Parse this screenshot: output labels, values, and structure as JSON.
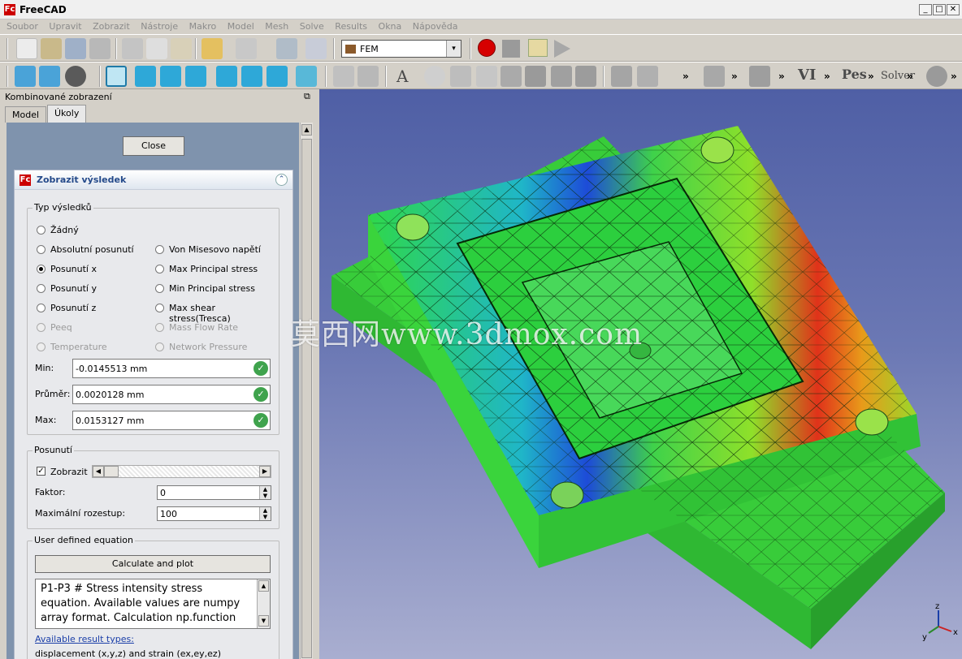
{
  "window": {
    "title": "FreeCAD",
    "logo": "Fc",
    "min": "_",
    "max": "□",
    "close": "✕"
  },
  "menu": [
    "Soubor",
    "Upravit",
    "Zobrazit",
    "Nástroje",
    "Makro",
    "Model",
    "Mesh",
    "Solve",
    "Results",
    "Okna",
    "Nápověda"
  ],
  "toolbar": {
    "workbench": "FEM",
    "workbench_arrow": "▾",
    "chevron": "»",
    "text_tools": {
      "a": "A",
      "vi": "VI",
      "pes": "Pes",
      "solver": "Solver"
    }
  },
  "panel": {
    "title": "Kombinované zobrazení",
    "undock": "⧉",
    "tabs": [
      "Model",
      "Úkoly"
    ],
    "close_button": "Close",
    "task_title": "Zobrazit výsledek",
    "collapse": "⌃",
    "result_type": {
      "title": "Typ výsledků",
      "left": [
        "Žádný",
        "Absolutní posunutí",
        "Posunutí x",
        "Posunutí y",
        "Posunutí z",
        "Peeq",
        "Temperature"
      ],
      "right": [
        "Von Misesovo napětí",
        "Max Principal stress",
        "Min Principal stress",
        "Max shear stress(Tresca)",
        "Mass Flow Rate",
        "Network Pressure"
      ],
      "selected": "Posunutí x"
    },
    "stats": {
      "min_label": "Min:",
      "min": "-0.0145513 mm",
      "avg_label": "Průměr:",
      "avg": "0.0020128 mm",
      "max_label": "Max:",
      "max": "0.0153127 mm",
      "ok": "✓"
    },
    "displacement": {
      "title": "Posunutí",
      "show_label": "Zobrazit",
      "show_checked": "✓",
      "factor_label": "Faktor:",
      "factor": "0",
      "max_factor_label": "Maximální rozestup:",
      "max_factor": "100"
    },
    "equation": {
      "title": "User defined equation",
      "button": "Calculate and plot",
      "text": "P1-P3 # Stress intensity stress equation. Available values are numpy array format. Calculation np.function",
      "available_label": "Available result types:",
      "available_line": "displacement (x,y,z) and strain (ex,ey,ez)"
    }
  },
  "viewport": {
    "watermark": "莫西网www.3dmox.com",
    "axis": {
      "x": "x",
      "y": "y",
      "z": "z"
    }
  }
}
